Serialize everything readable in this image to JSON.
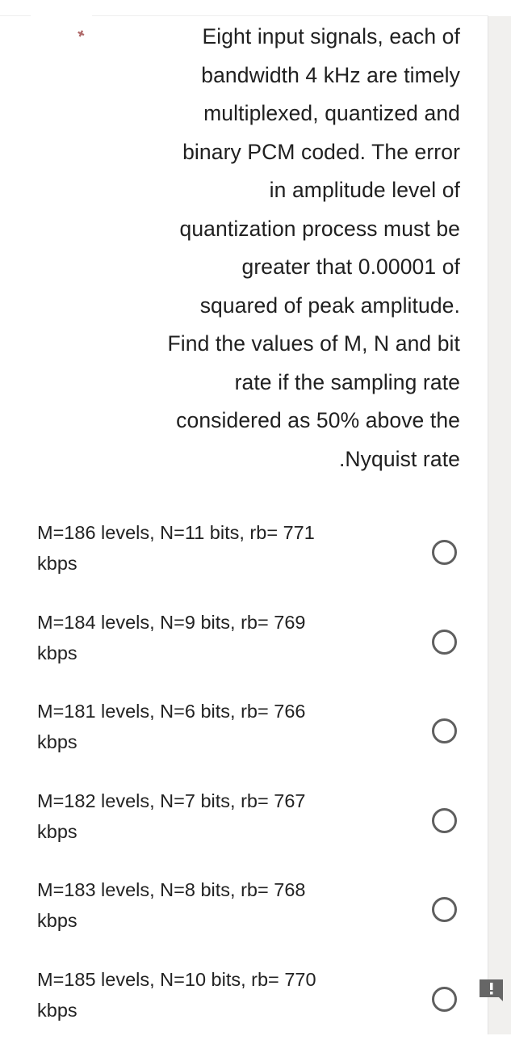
{
  "question": {
    "lines": [
      "Eight input signals, each of",
      "bandwidth 4 kHz are timely",
      "multiplexed, quantized and",
      "binary PCM coded. The error",
      "in amplitude level of",
      "quantization process must be",
      "greater that 0.00001 of",
      "squared of peak amplitude.",
      "Find the values of M, N and bit",
      "rate if the sampling rate",
      "considered as 50% above the",
      ".Nyquist rate"
    ]
  },
  "options": [
    {
      "line1": "M=186 levels, N=11 bits, rb= 771",
      "line2": "kbps",
      "selected": false
    },
    {
      "line1": "M=184 levels, N=9 bits, rb= 769",
      "line2": "kbps",
      "selected": false
    },
    {
      "line1": "M=181 levels, N=6 bits, rb= 766",
      "line2": "kbps",
      "selected": false
    },
    {
      "line1": "M=182 levels, N=7 bits, rb= 767",
      "line2": "kbps",
      "selected": false
    },
    {
      "line1": "M=183 levels, N=8 bits, rb= 768",
      "line2": "kbps",
      "selected": false
    },
    {
      "line1": "M=185 levels, N=10 bits, rb= 770",
      "line2": "kbps",
      "selected": false
    }
  ],
  "icons": {
    "corner_mark": "pin-mark-icon",
    "feedback": "feedback-exclamation-icon"
  },
  "colors": {
    "text": "#202020",
    "radio_border": "#5f5f5f",
    "feedback_icon": "#666666",
    "gutter": "#f1f0ee"
  }
}
